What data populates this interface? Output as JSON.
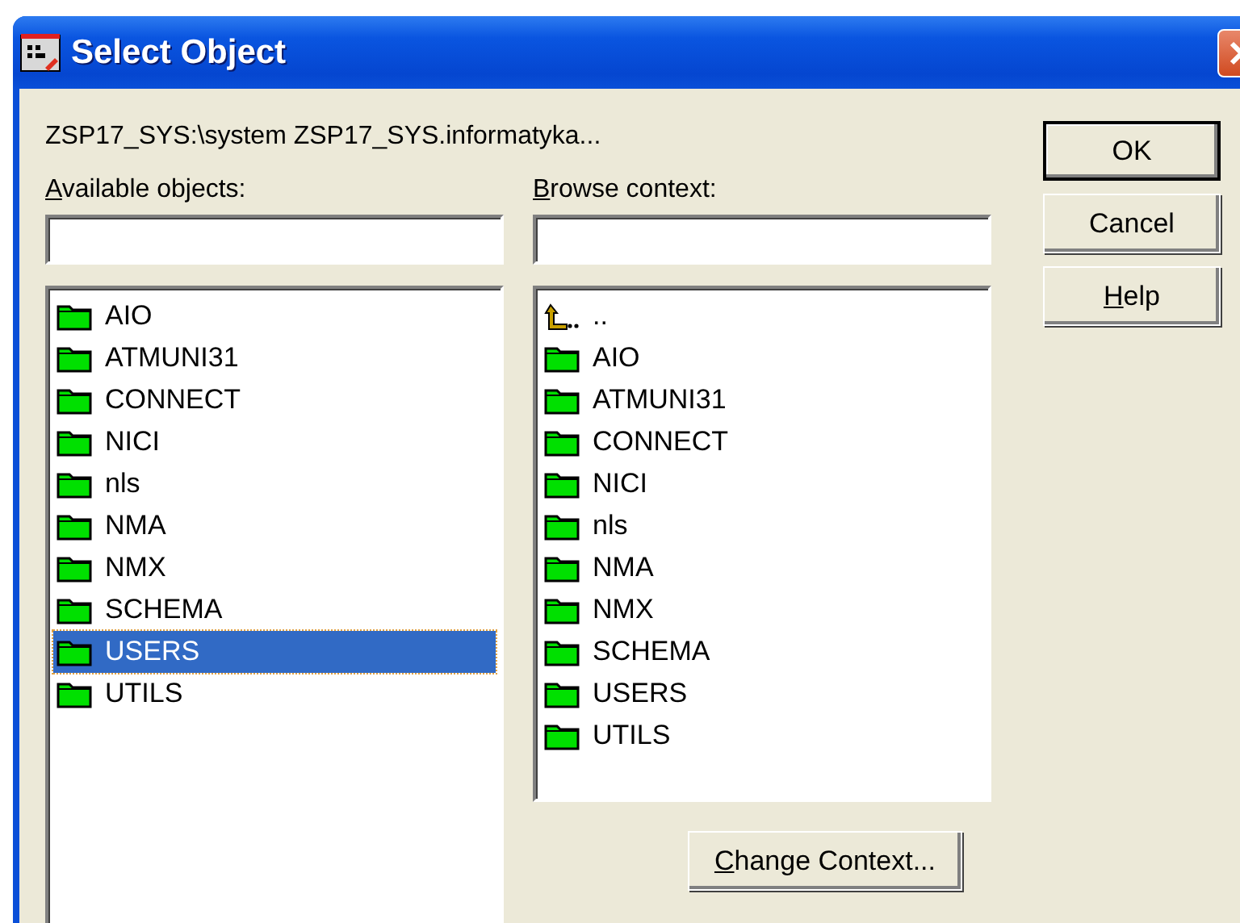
{
  "window": {
    "title": "Select Object"
  },
  "path": "ZSP17_SYS:\\system ZSP17_SYS.informatyka...",
  "available": {
    "label": "Available objects:",
    "first_letter_underlined": true,
    "items": [
      {
        "kind": "folder",
        "name": "AIO",
        "selected": false
      },
      {
        "kind": "folder",
        "name": "ATMUNI31",
        "selected": false
      },
      {
        "kind": "folder",
        "name": "CONNECT",
        "selected": false
      },
      {
        "kind": "folder",
        "name": "NICI",
        "selected": false
      },
      {
        "kind": "folder",
        "name": "nls",
        "selected": false
      },
      {
        "kind": "folder",
        "name": "NMA",
        "selected": false
      },
      {
        "kind": "folder",
        "name": "NMX",
        "selected": false
      },
      {
        "kind": "folder",
        "name": "SCHEMA",
        "selected": false
      },
      {
        "kind": "folder",
        "name": "USERS",
        "selected": true
      },
      {
        "kind": "folder",
        "name": "UTILS",
        "selected": false
      }
    ]
  },
  "browse": {
    "label": "Browse context:",
    "first_letter_underlined": true,
    "items": [
      {
        "kind": "parent",
        "name": "..",
        "selected": false
      },
      {
        "kind": "folder",
        "name": "AIO",
        "selected": false
      },
      {
        "kind": "folder",
        "name": "ATMUNI31",
        "selected": false
      },
      {
        "kind": "folder",
        "name": "CONNECT",
        "selected": false
      },
      {
        "kind": "folder",
        "name": "NICI",
        "selected": false
      },
      {
        "kind": "folder",
        "name": "nls",
        "selected": false
      },
      {
        "kind": "folder",
        "name": "NMA",
        "selected": false
      },
      {
        "kind": "folder",
        "name": "NMX",
        "selected": false
      },
      {
        "kind": "folder",
        "name": "SCHEMA",
        "selected": false
      },
      {
        "kind": "folder",
        "name": "USERS",
        "selected": false
      },
      {
        "kind": "folder",
        "name": "UTILS",
        "selected": false
      }
    ]
  },
  "buttons": [
    {
      "label": "OK",
      "default": true
    },
    {
      "label": "Cancel",
      "default": false
    },
    {
      "label": "Help",
      "first_letter_underlined": true,
      "default": false
    }
  ],
  "change_context": {
    "label": "Change Context...",
    "first_letter_underlined": true
  }
}
